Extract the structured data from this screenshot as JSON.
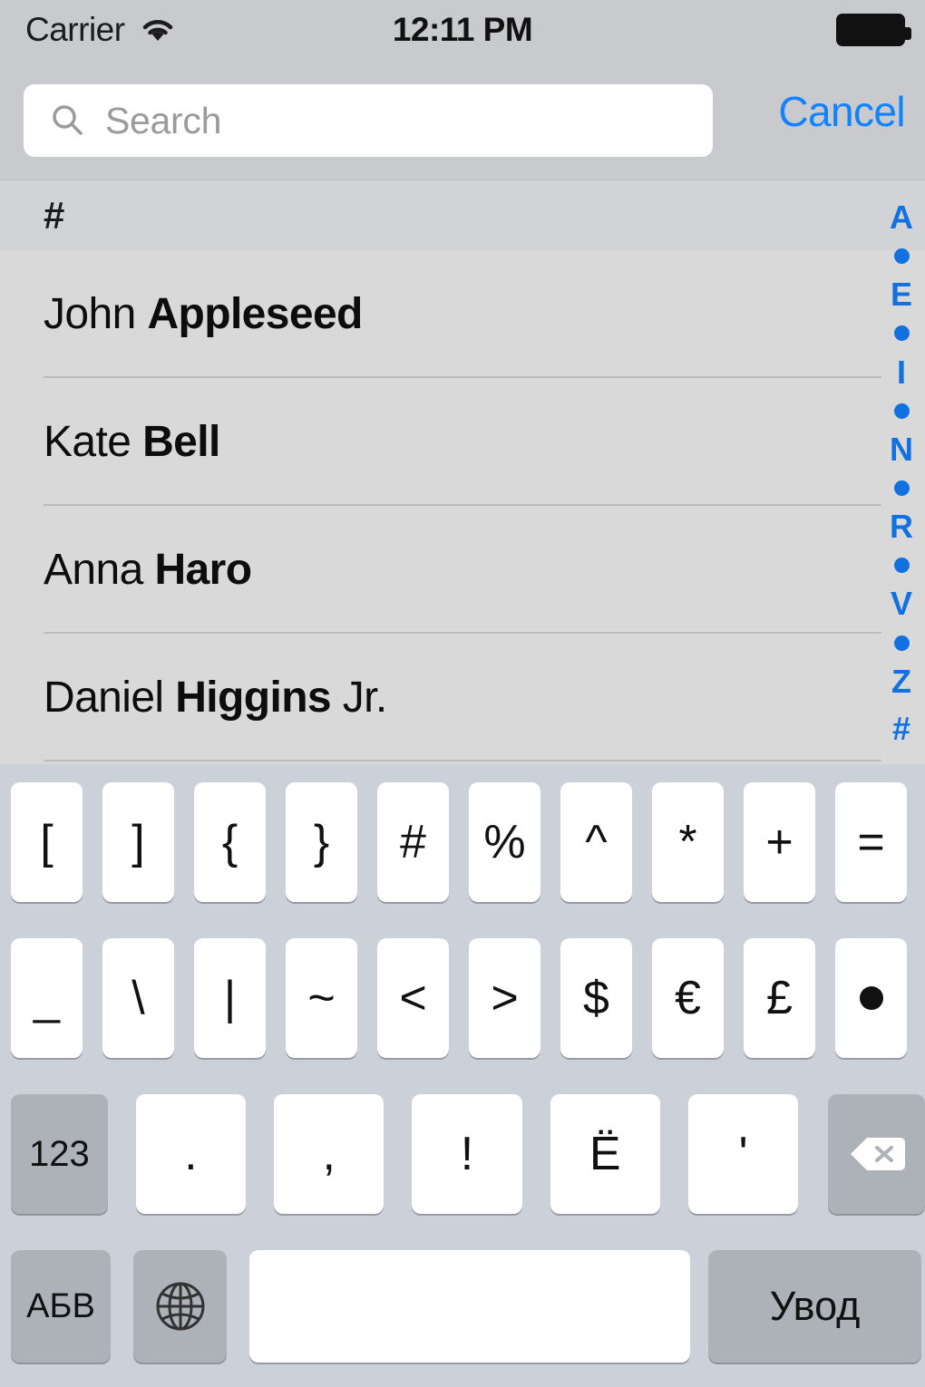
{
  "status_bar": {
    "carrier": "Carrier",
    "wifi_icon": "wifi-icon",
    "time": "12:11 PM",
    "battery_icon": "battery-full-icon"
  },
  "search": {
    "placeholder": "Search",
    "value": "",
    "icon": "search-icon",
    "cancel_label": "Cancel"
  },
  "contacts": {
    "section_header": "#",
    "rows": [
      {
        "first": "John ",
        "last": "Appleseed",
        "suffix": ""
      },
      {
        "first": "Kate ",
        "last": "Bell",
        "suffix": ""
      },
      {
        "first": "Anna ",
        "last": "Haro",
        "suffix": ""
      },
      {
        "first": "Daniel ",
        "last": "Higgins",
        "suffix": " Jr."
      }
    ]
  },
  "index_bar": {
    "entries": [
      "A",
      "•",
      "E",
      "•",
      "I",
      "•",
      "N",
      "•",
      "R",
      "•",
      "V",
      "•",
      "Z",
      "#"
    ],
    "color": "#1271e0"
  },
  "keyboard": {
    "language": "Russian",
    "row1": [
      "[",
      "]",
      "{",
      "}",
      "#",
      "%",
      "^",
      "*",
      "+",
      "="
    ],
    "row2": [
      "_",
      "\\",
      "|",
      "~",
      "<",
      ">",
      "$",
      "€",
      "£",
      "•"
    ],
    "row3": {
      "numbers_label": "123",
      "punct": [
        ".",
        ",",
        "!",
        "Ё",
        "'"
      ],
      "backspace_icon": "backspace-icon"
    },
    "row4": {
      "letters_label": "АБВ",
      "globe_icon": "globe-icon",
      "space_label": "",
      "enter_label": "Увод"
    }
  },
  "colors": {
    "accent_blue": "#1283ff",
    "index_blue": "#1271e0",
    "keyboard_bg": "#ccd0d9",
    "key_white": "#ffffff",
    "key_gray": "#adb1b8",
    "list_bg": "#d9d9da",
    "chrome_bg": "#c8cace"
  }
}
